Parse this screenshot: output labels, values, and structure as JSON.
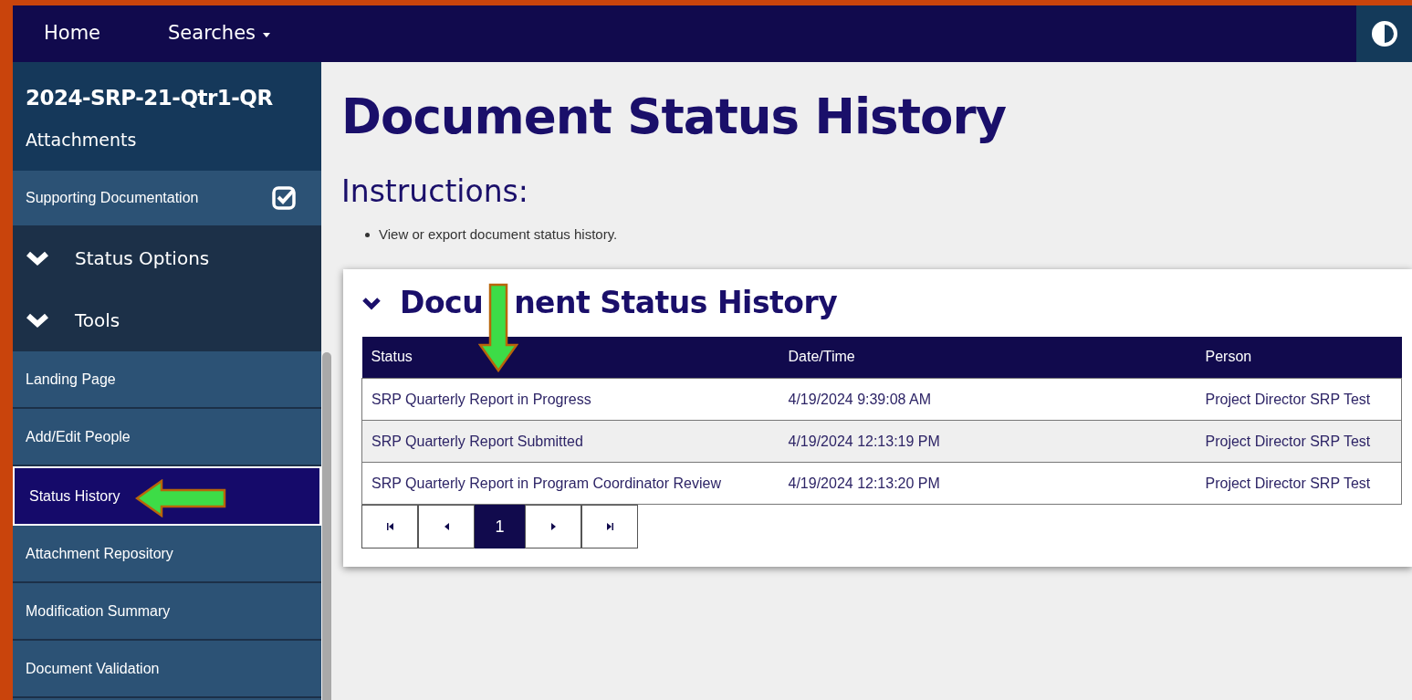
{
  "navbar": {
    "items": [
      {
        "label": "Home",
        "kind": "link"
      },
      {
        "label": "Searches",
        "kind": "dropdown"
      }
    ]
  },
  "sidebar": {
    "title": "2024-SRP-21-Qtr1-QR",
    "subtitle": "Attachments",
    "section_link": {
      "label": "Supporting Documentation",
      "completed": true
    },
    "groups": [
      {
        "label": "Status Options"
      },
      {
        "label": "Tools"
      }
    ],
    "items": [
      {
        "label": "Landing Page",
        "selected": false
      },
      {
        "label": "Add/Edit People",
        "selected": false
      },
      {
        "label": "Status History",
        "selected": true
      },
      {
        "label": "Attachment Repository",
        "selected": false
      },
      {
        "label": "Modification Summary",
        "selected": false
      },
      {
        "label": "Document Validation",
        "selected": false
      }
    ]
  },
  "page_title": "Document Status History",
  "instructions": {
    "heading": "Instructions:",
    "bullets": [
      "View or export document status history."
    ]
  },
  "panel": {
    "title_parts": [
      "Docu",
      "nent Status History"
    ],
    "expanded": true,
    "table": {
      "columns": [
        "Status",
        "Date/Time",
        "Person"
      ],
      "rows": [
        [
          "SRP Quarterly Report in Progress",
          "4/19/2024 9:39:08 AM",
          "Project Director SRP Test"
        ],
        [
          "SRP Quarterly Report Submitted",
          "4/19/2024 12:13:19 PM",
          "Project Director SRP Test"
        ],
        [
          "SRP Quarterly Report in Program Coordinator Review",
          "4/19/2024 12:13:20 PM",
          "Project Director SRP Test"
        ]
      ]
    },
    "pager": [
      {
        "kind": "first",
        "selected": false
      },
      {
        "kind": "prev",
        "selected": false
      },
      {
        "kind": "page",
        "label": "1",
        "selected": true
      },
      {
        "kind": "next",
        "selected": false
      },
      {
        "kind": "last",
        "selected": false
      }
    ]
  },
  "annotations": [
    {
      "kind": "down-arrow"
    },
    {
      "kind": "left-arrow"
    }
  ]
}
